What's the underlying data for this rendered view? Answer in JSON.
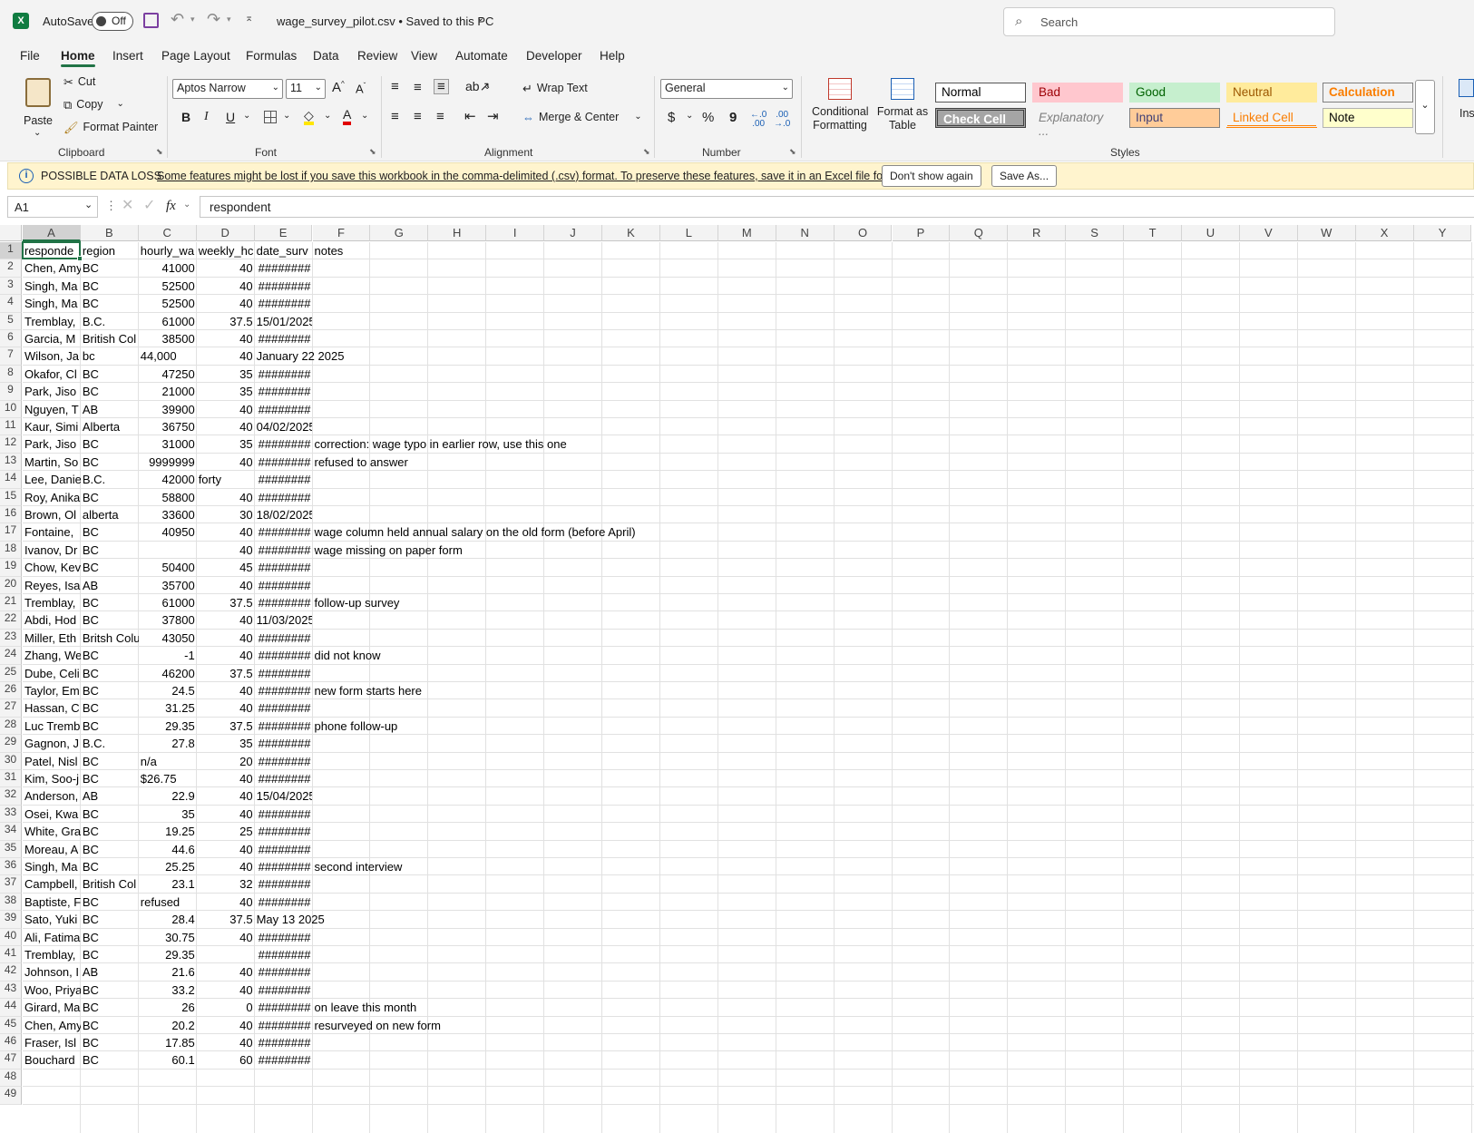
{
  "titlebar": {
    "autosave_label": "AutoSave",
    "autosave_state": "Off",
    "file_title": "wage_survey_pilot.csv • Saved to this PC",
    "search_placeholder": "Search"
  },
  "menu": [
    "File",
    "Home",
    "Insert",
    "Page Layout",
    "Formulas",
    "Data",
    "Review",
    "View",
    "Automate",
    "Developer",
    "Help"
  ],
  "ribbon": {
    "clipboard": {
      "paste": "Paste",
      "cut": "Cut",
      "copy": "Copy",
      "format_painter": "Format Painter",
      "group": "Clipboard"
    },
    "font": {
      "name": "Aptos Narrow",
      "size": "11",
      "bold": "B",
      "italic": "I",
      "underline": "U",
      "group": "Font"
    },
    "alignment": {
      "wrap_text": "Wrap Text",
      "merge_center": "Merge & Center",
      "group": "Alignment"
    },
    "number": {
      "format": "General",
      "currency": "$",
      "percent": "%",
      "comma": "9",
      "group": "Number"
    },
    "styles": {
      "conditional_formatting": "Conditional Formatting",
      "format_as_table": "Format as Table",
      "group": "Styles",
      "cells": [
        "Normal",
        "Bad",
        "Good",
        "Neutral",
        "Calculation",
        "Check Cell",
        "Explanatory ...",
        "Input",
        "Linked Cell",
        "Note"
      ]
    },
    "insert_partial": "Ins"
  },
  "message_bar": {
    "title": "POSSIBLE DATA LOSS",
    "text": "Some features might be lost if you save this workbook in the comma-delimited (.csv) format. To preserve these features, save it in an Excel file format.",
    "dont_show": "Don't show again",
    "save_as": "Save As..."
  },
  "formula_bar": {
    "name_box": "A1",
    "formula": "respondent",
    "fx": "fx"
  },
  "columns": [
    "A",
    "B",
    "C",
    "D",
    "E",
    "F",
    "G",
    "H",
    "I",
    "J",
    "K",
    "L",
    "M",
    "N",
    "O",
    "P",
    "Q",
    "R",
    "S",
    "T",
    "U",
    "V",
    "W",
    "X",
    "Y"
  ],
  "sheet": {
    "rows": [
      [
        "responde",
        "region",
        "hourly_wa",
        "weekly_hc",
        "date_surv",
        "notes"
      ],
      [
        "Chen, Amy",
        "BC",
        "41000",
        "40",
        "########",
        ""
      ],
      [
        "Singh, Ma",
        "BC",
        "52500",
        "40",
        "########",
        ""
      ],
      [
        "Singh, Ma",
        "BC",
        "52500",
        "40",
        "########",
        ""
      ],
      [
        "Tremblay,",
        "B.C.",
        "61000",
        "37.5",
        "15/01/2025",
        ""
      ],
      [
        "Garcia, M",
        "British Col",
        "38500",
        "40",
        "########",
        ""
      ],
      [
        "Wilson, Ja",
        "bc",
        "44,000",
        "40",
        "January 22 2025",
        ""
      ],
      [
        "Okafor, Cl",
        "BC",
        "47250",
        "35",
        "########",
        ""
      ],
      [
        "Park, Jiso",
        "BC",
        "21000",
        "35",
        "########",
        ""
      ],
      [
        "Nguyen, T",
        "AB",
        "39900",
        "40",
        "########",
        ""
      ],
      [
        "Kaur, Simi",
        "Alberta",
        "36750",
        "40",
        "04/02/2025",
        ""
      ],
      [
        "Park, Jiso",
        "BC",
        "31000",
        "35",
        "########",
        "correction: wage typo in earlier row, use this one"
      ],
      [
        "Martin, So",
        "BC",
        "9999999",
        "40",
        "########",
        "refused to answer"
      ],
      [
        "Lee, Danie",
        "B.C.",
        "42000",
        "forty",
        "########",
        ""
      ],
      [
        "Roy, Anika",
        "BC",
        "58800",
        "40",
        "########",
        ""
      ],
      [
        "Brown, Ol",
        "alberta",
        "33600",
        "30",
        "18/02/2025",
        ""
      ],
      [
        "Fontaine,",
        "BC",
        "40950",
        "40",
        "########",
        "wage column held annual salary on the old form (before April)"
      ],
      [
        "Ivanov, Dr",
        "BC",
        "",
        "40",
        "########",
        "wage missing on paper form"
      ],
      [
        "Chow, Kev",
        "BC",
        "50400",
        "45",
        "########",
        ""
      ],
      [
        "Reyes, Isa",
        "AB",
        "35700",
        "40",
        "########",
        ""
      ],
      [
        "Tremblay,",
        "BC",
        "61000",
        "37.5",
        "########",
        "follow-up survey"
      ],
      [
        "Abdi, Hod",
        "BC",
        "37800",
        "40",
        "11/03/2025",
        ""
      ],
      [
        "Miller, Eth",
        "Britsh Colu",
        "43050",
        "40",
        "########",
        ""
      ],
      [
        "Zhang, We",
        "BC",
        "-1",
        "40",
        "########",
        "did not know"
      ],
      [
        "Dube, Celi",
        "BC",
        "46200",
        "37.5",
        "########",
        ""
      ],
      [
        "Taylor, Em",
        "BC",
        "24.5",
        "40",
        "########",
        "new form starts here"
      ],
      [
        "Hassan, C",
        "BC",
        "31.25",
        "40",
        "########",
        ""
      ],
      [
        "Luc Tremb",
        "BC",
        "29.35",
        "37.5",
        "########",
        "phone follow-up"
      ],
      [
        "Gagnon, J",
        "B.C.",
        "27.8",
        "35",
        "########",
        ""
      ],
      [
        "Patel, Nisl",
        "BC",
        "n/a",
        "20",
        "########",
        ""
      ],
      [
        "Kim, Soo-j",
        "BC",
        "$26.75",
        "40",
        "########",
        ""
      ],
      [
        "Anderson,",
        "AB",
        "22.9",
        "40",
        "15/04/2025",
        ""
      ],
      [
        "Osei, Kwa",
        "BC",
        "35",
        "40",
        "########",
        ""
      ],
      [
        "White, Gra",
        "BC",
        "19.25",
        "25",
        "########",
        ""
      ],
      [
        "Moreau, A",
        "BC",
        "44.6",
        "40",
        "########",
        ""
      ],
      [
        "Singh, Ma",
        "BC",
        "25.25",
        "40",
        "########",
        "second interview"
      ],
      [
        "Campbell,",
        "British Col",
        "23.1",
        "32",
        "########",
        ""
      ],
      [
        "Baptiste, F",
        "BC",
        "refused",
        "40",
        "########",
        ""
      ],
      [
        "Sato, Yuki",
        "BC",
        "28.4",
        "37.5",
        "May 13 2025",
        ""
      ],
      [
        "Ali, Fatima",
        "BC",
        "30.75",
        "40",
        "########",
        ""
      ],
      [
        "Tremblay,",
        "BC",
        "29.35",
        "",
        "########",
        ""
      ],
      [
        "Johnson, I",
        "AB",
        "21.6",
        "40",
        "########",
        ""
      ],
      [
        "Woo, Priya",
        "BC",
        "33.2",
        "40",
        "########",
        ""
      ],
      [
        "Girard, Ma",
        "BC",
        "26",
        "0",
        "########",
        "on leave this month"
      ],
      [
        "Chen, Amy",
        "BC",
        "20.2",
        "40",
        "########",
        "resurveyed on new form"
      ],
      [
        "Fraser, Isl",
        "BC",
        "17.85",
        "40",
        "########",
        ""
      ],
      [
        "Bouchard",
        "BC",
        "60.1",
        "60",
        "########",
        ""
      ],
      [
        "",
        "",
        "",
        "",
        "",
        ""
      ],
      [
        "",
        "",
        "",
        "",
        "",
        ""
      ]
    ]
  }
}
